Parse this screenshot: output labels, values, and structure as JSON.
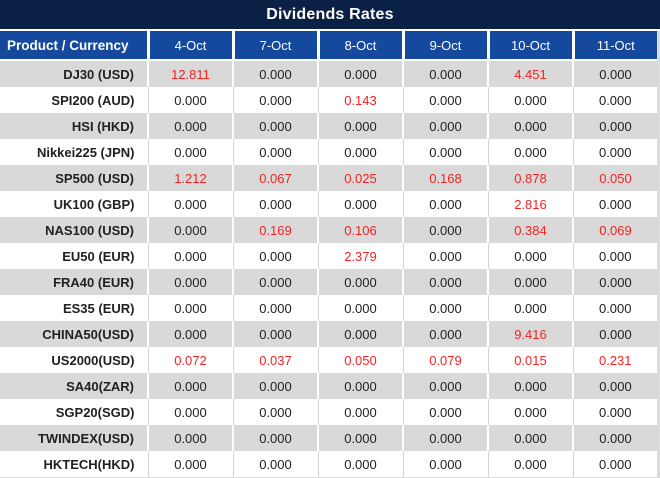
{
  "title": "Dividends Rates",
  "table": {
    "product_header": "Product / Currency",
    "date_headers": [
      "4-Oct",
      "7-Oct",
      "8-Oct",
      "9-Oct",
      "10-Oct",
      "11-Oct"
    ],
    "rows": [
      {
        "product": "DJ30 (USD)",
        "values": [
          "12.811",
          "0.000",
          "0.000",
          "0.000",
          "4.451",
          "0.000"
        ],
        "red": [
          true,
          false,
          false,
          false,
          true,
          false
        ]
      },
      {
        "product": "SPI200 (AUD)",
        "values": [
          "0.000",
          "0.000",
          "0.143",
          "0.000",
          "0.000",
          "0.000"
        ],
        "red": [
          false,
          false,
          true,
          false,
          false,
          false
        ]
      },
      {
        "product": "HSI (HKD)",
        "values": [
          "0.000",
          "0.000",
          "0.000",
          "0.000",
          "0.000",
          "0.000"
        ],
        "red": [
          false,
          false,
          false,
          false,
          false,
          false
        ]
      },
      {
        "product": "Nikkei225 (JPN)",
        "values": [
          "0.000",
          "0.000",
          "0.000",
          "0.000",
          "0.000",
          "0.000"
        ],
        "red": [
          false,
          false,
          false,
          false,
          false,
          false
        ]
      },
      {
        "product": "SP500 (USD)",
        "values": [
          "1.212",
          "0.067",
          "0.025",
          "0.168",
          "0.878",
          "0.050"
        ],
        "red": [
          true,
          true,
          true,
          true,
          true,
          true
        ]
      },
      {
        "product": "UK100 (GBP)",
        "values": [
          "0.000",
          "0.000",
          "0.000",
          "0.000",
          "2.816",
          "0.000"
        ],
        "red": [
          false,
          false,
          false,
          false,
          true,
          false
        ]
      },
      {
        "product": "NAS100 (USD)",
        "values": [
          "0.000",
          "0.169",
          "0.106",
          "0.000",
          "0.384",
          "0.069"
        ],
        "red": [
          false,
          true,
          true,
          false,
          true,
          true
        ]
      },
      {
        "product": "EU50 (EUR)",
        "values": [
          "0.000",
          "0.000",
          "2.379",
          "0.000",
          "0.000",
          "0.000"
        ],
        "red": [
          false,
          false,
          true,
          false,
          false,
          false
        ]
      },
      {
        "product": "FRA40 (EUR)",
        "values": [
          "0.000",
          "0.000",
          "0.000",
          "0.000",
          "0.000",
          "0.000"
        ],
        "red": [
          false,
          false,
          false,
          false,
          false,
          false
        ]
      },
      {
        "product": "ES35 (EUR)",
        "values": [
          "0.000",
          "0.000",
          "0.000",
          "0.000",
          "0.000",
          "0.000"
        ],
        "red": [
          false,
          false,
          false,
          false,
          false,
          false
        ]
      },
      {
        "product": "CHINA50(USD)",
        "values": [
          "0.000",
          "0.000",
          "0.000",
          "0.000",
          "9.416",
          "0.000"
        ],
        "red": [
          false,
          false,
          false,
          false,
          true,
          false
        ]
      },
      {
        "product": "US2000(USD)",
        "values": [
          "0.072",
          "0.037",
          "0.050",
          "0.079",
          "0.015",
          "0.231"
        ],
        "red": [
          true,
          true,
          true,
          true,
          true,
          true
        ]
      },
      {
        "product": "SA40(ZAR)",
        "values": [
          "0.000",
          "0.000",
          "0.000",
          "0.000",
          "0.000",
          "0.000"
        ],
        "red": [
          false,
          false,
          false,
          false,
          false,
          false
        ]
      },
      {
        "product": "SGP20(SGD)",
        "values": [
          "0.000",
          "0.000",
          "0.000",
          "0.000",
          "0.000",
          "0.000"
        ],
        "red": [
          false,
          false,
          false,
          false,
          false,
          false
        ]
      },
      {
        "product": "TWINDEX(USD)",
        "values": [
          "0.000",
          "0.000",
          "0.000",
          "0.000",
          "0.000",
          "0.000"
        ],
        "red": [
          false,
          false,
          false,
          false,
          false,
          false
        ]
      },
      {
        "product": "HKTECH(HKD)",
        "values": [
          "0.000",
          "0.000",
          "0.000",
          "0.000",
          "0.000",
          "0.000"
        ],
        "red": [
          false,
          false,
          false,
          false,
          false,
          false
        ]
      }
    ]
  },
  "colors": {
    "title_bg": "#0b2045",
    "header_bg": "#15499e",
    "row_alt_bg": "#d9d9d9",
    "row_bg": "#ffffff",
    "value_red": "#f52222",
    "text_dark": "#212121",
    "header_text": "#ffffff"
  },
  "chart_data": {
    "type": "table",
    "title": "Dividends Rates",
    "columns": [
      "Product / Currency",
      "4-Oct",
      "7-Oct",
      "8-Oct",
      "9-Oct",
      "10-Oct",
      "11-Oct"
    ],
    "rows": [
      [
        "DJ30 (USD)",
        12.811,
        0.0,
        0.0,
        0.0,
        4.451,
        0.0
      ],
      [
        "SPI200 (AUD)",
        0.0,
        0.0,
        0.143,
        0.0,
        0.0,
        0.0
      ],
      [
        "HSI (HKD)",
        0.0,
        0.0,
        0.0,
        0.0,
        0.0,
        0.0
      ],
      [
        "Nikkei225 (JPN)",
        0.0,
        0.0,
        0.0,
        0.0,
        0.0,
        0.0
      ],
      [
        "SP500 (USD)",
        1.212,
        0.067,
        0.025,
        0.168,
        0.878,
        0.05
      ],
      [
        "UK100 (GBP)",
        0.0,
        0.0,
        0.0,
        0.0,
        2.816,
        0.0
      ],
      [
        "NAS100 (USD)",
        0.0,
        0.169,
        0.106,
        0.0,
        0.384,
        0.069
      ],
      [
        "EU50 (EUR)",
        0.0,
        0.0,
        2.379,
        0.0,
        0.0,
        0.0
      ],
      [
        "FRA40 (EUR)",
        0.0,
        0.0,
        0.0,
        0.0,
        0.0,
        0.0
      ],
      [
        "ES35 (EUR)",
        0.0,
        0.0,
        0.0,
        0.0,
        0.0,
        0.0
      ],
      [
        "CHINA50(USD)",
        0.0,
        0.0,
        0.0,
        0.0,
        9.416,
        0.0
      ],
      [
        "US2000(USD)",
        0.072,
        0.037,
        0.05,
        0.079,
        0.015,
        0.231
      ],
      [
        "SA40(ZAR)",
        0.0,
        0.0,
        0.0,
        0.0,
        0.0,
        0.0
      ],
      [
        "SGP20(SGD)",
        0.0,
        0.0,
        0.0,
        0.0,
        0.0,
        0.0
      ],
      [
        "TWINDEX(USD)",
        0.0,
        0.0,
        0.0,
        0.0,
        0.0,
        0.0
      ],
      [
        "HKTECH(HKD)",
        0.0,
        0.0,
        0.0,
        0.0,
        0.0,
        0.0
      ]
    ],
    "highlight_rule": "non-zero dividend values rendered in red",
    "layout": "alternating gray/white rows, dark navy title bar, blue column header row"
  }
}
